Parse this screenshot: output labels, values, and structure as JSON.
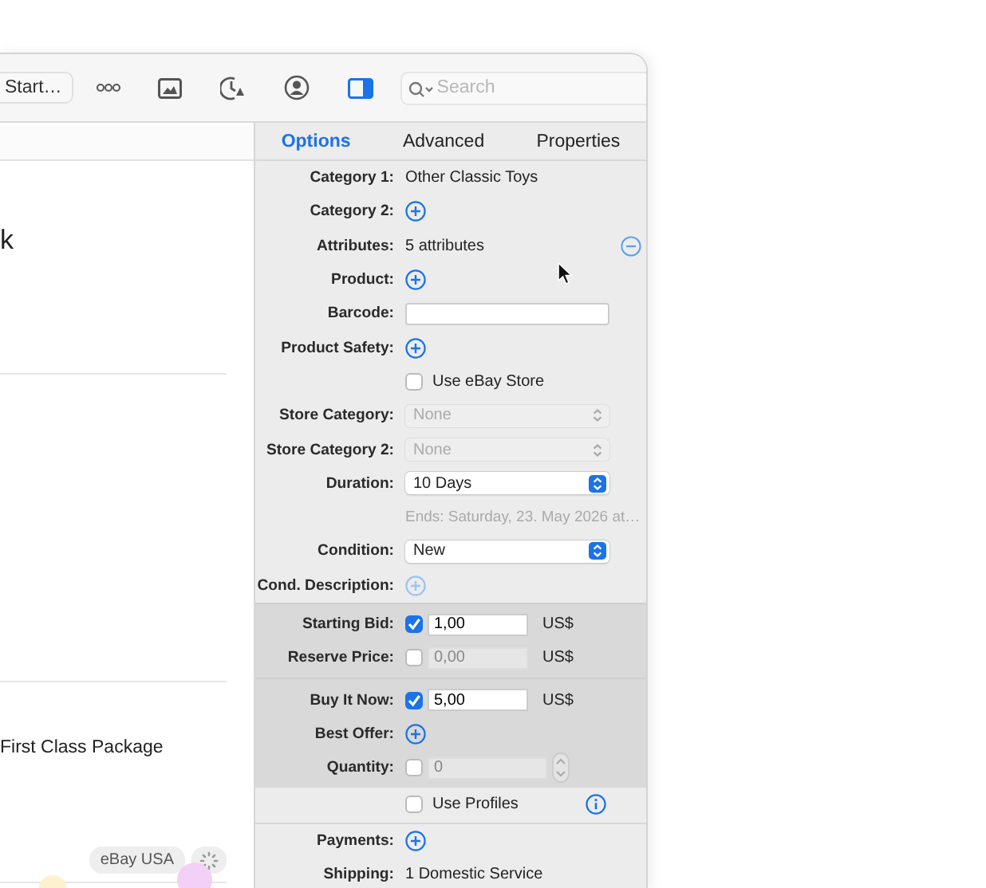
{
  "toolbar": {
    "items": [
      {
        "kind": "button",
        "label": "Start…",
        "selected": false
      },
      {
        "kind": "more",
        "selected": false
      },
      {
        "kind": "image",
        "selected": false
      },
      {
        "kind": "clock",
        "selected": false
      },
      {
        "kind": "person",
        "selected": false
      },
      {
        "kind": "sidebar",
        "selected": true
      }
    ],
    "search": {
      "placeholder": "Search"
    }
  },
  "list": {
    "title": "k",
    "shipping": "First Class Package",
    "site_badge": "eBay USA"
  },
  "tabs": [
    {
      "label": "Options",
      "selected": true
    },
    {
      "label": "Advanced",
      "selected": false
    },
    {
      "label": "Properties",
      "selected": false
    }
  ],
  "sections": [
    {
      "shaded": false,
      "rows": [
        {
          "kind": "text",
          "label": "Category 1:",
          "value": "Other Classic Toys"
        },
        {
          "kind": "plus",
          "label": "Category 2:",
          "disabled": false
        },
        {
          "kind": "text_minus",
          "label": "Attributes:",
          "value": "5 attributes"
        },
        {
          "kind": "plus",
          "label": "Product:",
          "disabled": false
        },
        {
          "kind": "field",
          "label": "Barcode:",
          "value": ""
        },
        {
          "kind": "plus",
          "label": "Product Safety:",
          "disabled": false
        },
        {
          "kind": "checkbox",
          "text": "Use eBay Store",
          "checked": false
        },
        {
          "kind": "popup",
          "label": "Store Category:",
          "value": "None",
          "disabled": true
        },
        {
          "kind": "popup",
          "label": "Store Category 2:",
          "value": "None",
          "disabled": true
        },
        {
          "kind": "popup",
          "label": "Duration:",
          "value": "10 Days",
          "disabled": false
        },
        {
          "kind": "note",
          "text": "Ends: Saturday, 23. May 2026 at…"
        },
        {
          "kind": "popup",
          "label": "Condition:",
          "value": "New",
          "disabled": false
        },
        {
          "kind": "plus",
          "label": "Cond. Description:",
          "disabled": true
        }
      ]
    },
    {
      "shaded": true,
      "rows": [
        {
          "kind": "price",
          "label": "Starting Bid:",
          "value": "1,00",
          "currency": "US$",
          "checked": true
        },
        {
          "kind": "price",
          "label": "Reserve Price:",
          "value": "0,00",
          "currency": "US$",
          "checked": false
        }
      ]
    },
    {
      "shaded": true,
      "rows": [
        {
          "kind": "price",
          "label": "Buy It Now:",
          "value": "5,00",
          "currency": "US$",
          "checked": true
        },
        {
          "kind": "plus",
          "label": "Best Offer:",
          "disabled": false
        },
        {
          "kind": "stepper",
          "label": "Quantity:",
          "value": "0",
          "checked": false
        }
      ]
    },
    {
      "shaded": false,
      "rows": [
        {
          "kind": "checkbox_info",
          "text": "Use Profiles",
          "checked": false
        },
        {
          "kind": "plus",
          "label": "Payments:",
          "disabled": false
        },
        {
          "kind": "text",
          "label": "Shipping:",
          "value": "1 Domestic Service"
        }
      ]
    }
  ]
}
